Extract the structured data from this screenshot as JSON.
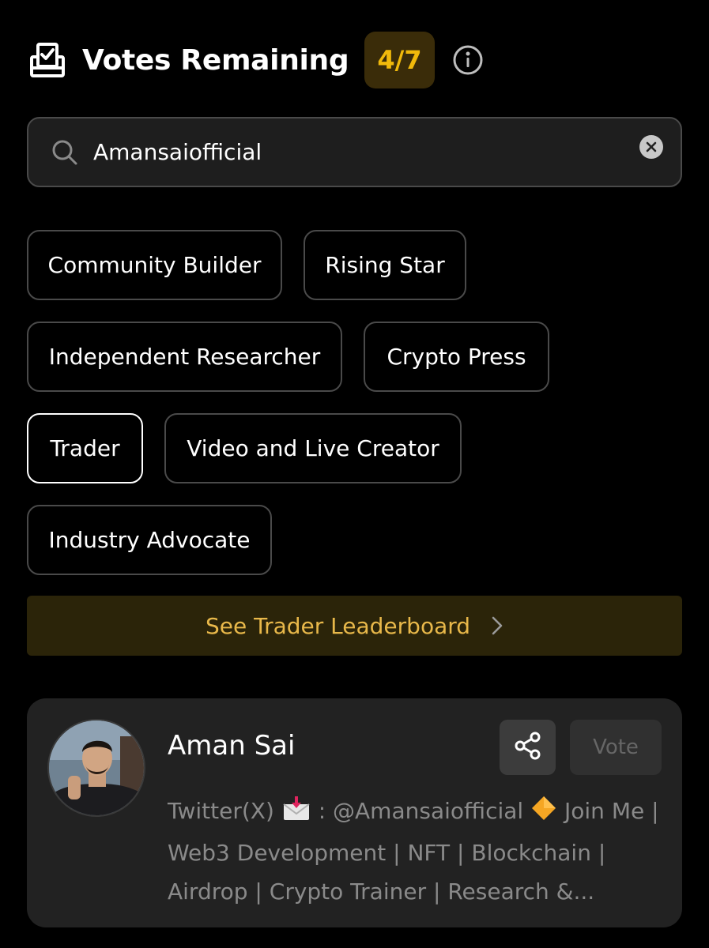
{
  "header": {
    "title": "Votes Remaining",
    "votes_count": "4/7"
  },
  "search": {
    "value": "Amansaiofficial"
  },
  "categories": [
    "Community Builder",
    "Rising Star",
    "Independent Researcher",
    "Crypto Press",
    "Trader",
    "Video and Live Creator",
    "Industry Advocate"
  ],
  "selected_category": "Trader",
  "leaderboard": {
    "label": "See Trader Leaderboard"
  },
  "candidate": {
    "name": "Aman Sai",
    "vote_label": "Vote",
    "bio_lines": [
      "Twitter(X)",
      ": @Amansaiofficial",
      "Join Me |",
      "Web3 Development | NFT | Blockchain |",
      "Airdrop | Crypto Trainer | Research &..."
    ]
  },
  "colors": {
    "background": "#000000",
    "accent": "#f0b90b",
    "badge_bg": "#3a2c09",
    "card_bg": "#222222"
  },
  "icons": [
    "ballot-check-icon",
    "info-icon",
    "search-icon",
    "clear-icon",
    "chevron-right-icon",
    "share-icon",
    "envelope-emoji-icon",
    "diamond-emoji-icon"
  ]
}
